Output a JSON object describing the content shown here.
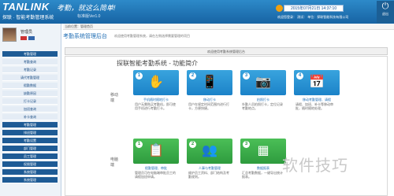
{
  "header": {
    "logo": "TANLINK",
    "slogan": "考勤，就这么简单!",
    "system_name": "探联 · 智能考勤管理系统",
    "version": "标准版Ver1.0",
    "datetime": "2015年07月21日 14:37:10",
    "welcome": "欢迎您登录：  测试：   单位：探联智能科技有限公司",
    "logout_label": "退出"
  },
  "sidebar": {
    "user_name": "管理员",
    "items": [
      {
        "label": "考勤管理",
        "style": "dark"
      },
      {
        "label": "考勤查询",
        "style": "light"
      },
      {
        "label": "考勤记录",
        "style": "light"
      },
      {
        "label": "请代考勤管理",
        "style": "light"
      },
      {
        "label": "假勤数据",
        "style": "light"
      },
      {
        "label": "缺勤原因",
        "style": "light"
      },
      {
        "label": "打卡记录",
        "style": "light"
      },
      {
        "label": "加班查询",
        "style": "light"
      },
      {
        "label": "补卡查询",
        "style": "light"
      },
      {
        "label": "考勤管理",
        "style": "dark"
      },
      {
        "label": "排班管理",
        "style": "dark"
      },
      {
        "label": "考勤设置",
        "style": "dark"
      },
      {
        "label": "部门管理",
        "style": "dark"
      },
      {
        "label": "员工管理",
        "style": "dark"
      },
      {
        "label": "权限管理",
        "style": "dark"
      },
      {
        "label": "系统管理",
        "style": "dark"
      },
      {
        "label": "系统管理",
        "style": "dark"
      }
    ]
  },
  "main": {
    "breadcrumb": "当前位置：管理首页",
    "page_title": "考勤系统管理后台",
    "page_subtitle": "欢迎使用考勤管理系统，请在左侧选择需要管理的项目",
    "panel_header": "欢迎使用考勤系统管理后台",
    "intro_title": "探联智能考勤系统 - 功能简介",
    "section_labels": [
      "移动端",
      "电脑端"
    ],
    "cards": [
      {
        "num": "1",
        "title": "手机随时随地打卡",
        "desc": "用户无需购买考勤机，即可使用手机进行考勤打卡。",
        "color": "blue",
        "glyph": "✋"
      },
      {
        "num": "2",
        "title": "移动打卡",
        "desc": "用户在规定时间范围内进行打卡，方便快捷。",
        "color": "blue",
        "glyph": "📱"
      },
      {
        "num": "3",
        "title": "拍照打卡",
        "desc": "外勤人员拍照打卡，定位记录考勤地点。",
        "color": "blue",
        "glyph": "📷"
      },
      {
        "num": "4",
        "title": "移动考勤管理、请假",
        "desc": "请假、加班、补卡等移动审批，随时随地处理。",
        "color": "blue",
        "glyph": "📅"
      },
      {
        "num": "1",
        "title": "假勤管理、审批",
        "desc": "管理员可在电脑端审批员工的请假加班申请。",
        "color": "green",
        "glyph": "📋"
      },
      {
        "num": "2",
        "title": "人事与考勤管理",
        "desc": "维护员工资料、部门结构及考勤规则。",
        "color": "green",
        "glyph": "👥"
      },
      {
        "num": "3",
        "title": "数据报表",
        "desc": "汇总考勤数据，一键导出统计报表。",
        "color": "green",
        "glyph": "▦"
      }
    ]
  },
  "watermark": "软件技巧"
}
